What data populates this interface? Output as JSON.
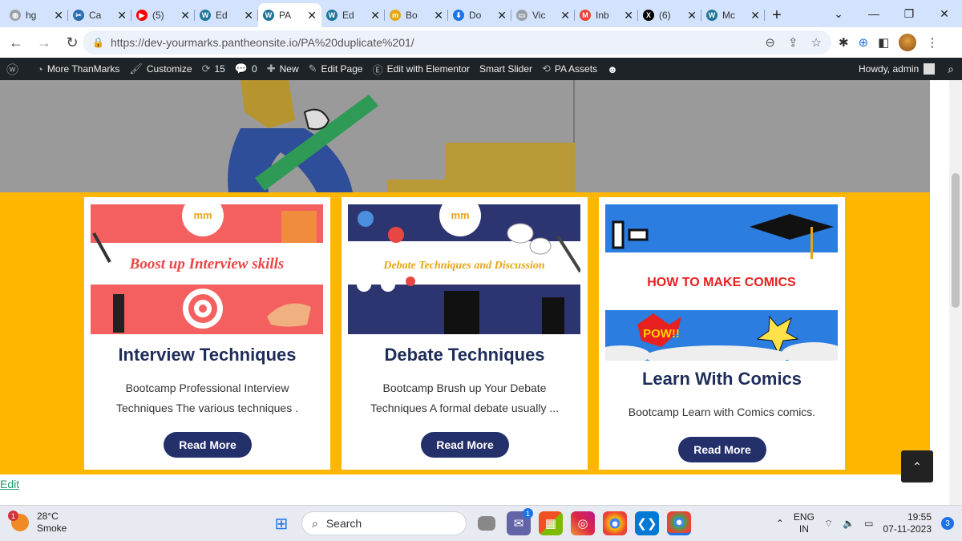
{
  "browser": {
    "tabs": [
      {
        "title": "hg",
        "color": "#9aa0a6",
        "glyph": "◍",
        "active": false
      },
      {
        "title": "Ca",
        "color": "#2b6cb0",
        "glyph": "✂",
        "active": false
      },
      {
        "title": "(5)",
        "color": "#ff0000",
        "glyph": "▶",
        "active": false
      },
      {
        "title": "Ed",
        "color": "#21759b",
        "glyph": "W",
        "active": false
      },
      {
        "title": "PA",
        "color": "#21759b",
        "glyph": "W",
        "active": true
      },
      {
        "title": "Ed",
        "color": "#21759b",
        "glyph": "W",
        "active": false
      },
      {
        "title": "Bo",
        "color": "#e8a317",
        "glyph": "m",
        "active": false
      },
      {
        "title": "Do",
        "color": "#1a73e8",
        "glyph": "⬇",
        "active": false
      },
      {
        "title": "Vic",
        "color": "#9aa0a6",
        "glyph": "▭",
        "active": false
      },
      {
        "title": "Inb",
        "color": "#ea4335",
        "glyph": "M",
        "active": false
      },
      {
        "title": "(6)",
        "color": "#000000",
        "glyph": "X",
        "active": false
      },
      {
        "title": "Mc",
        "color": "#21759b",
        "glyph": "W",
        "active": false
      }
    ],
    "url": "https://dev-yourmarks.pantheonsite.io/PA%20duplicate%201/"
  },
  "adminbar": {
    "site_name": "More ThanMarks",
    "customize": "Customize",
    "updates": "15",
    "comments": "0",
    "new": "New",
    "edit_page": "Edit Page",
    "elementor": "Edit with Elementor",
    "smart_slider": "Smart Slider",
    "pa_assets": "PA Assets",
    "howdy": "Howdy, admin"
  },
  "cards": [
    {
      "banner_top": "Boost up Interview skills",
      "title": "Interview Techniques",
      "excerpt": "Bootcamp Professional Interview Techniques The various techniques .",
      "button": "Read More"
    },
    {
      "banner_top": "Debate Techniques and Discussion",
      "title": "Debate Techniques",
      "excerpt": "Bootcamp Brush up Your Debate Techniques A formal debate usually ...",
      "button": "Read More"
    },
    {
      "banner_top": "HOW TO MAKE COMICS",
      "banner_pow": "POW!!",
      "title": "Learn With Comics",
      "excerpt": "Bootcamp Learn with Comics comics.",
      "button": "Read More"
    }
  ],
  "edit_link": "Edit",
  "taskbar": {
    "temp": "28°C",
    "weather": "Smoke",
    "weather_badge": "1",
    "search": "Search",
    "chat_badge": "1",
    "lang_top": "ENG",
    "lang_bottom": "IN",
    "time": "19:55",
    "date": "07-11-2023",
    "notifications": "3"
  },
  "colors": {
    "yellow_band": "#ffb600",
    "card_title": "#1f2d5a",
    "button": "#24306a"
  }
}
